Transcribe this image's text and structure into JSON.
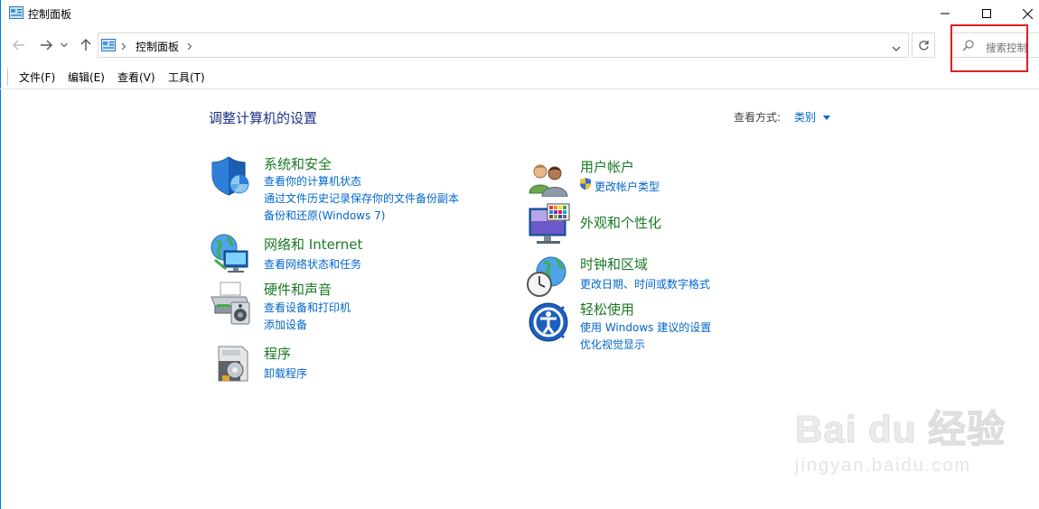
{
  "window": {
    "title": "控制面板"
  },
  "address_bar": {
    "path": "控制面板",
    "search_placeholder": "搜索控制"
  },
  "menu": [
    "文件(F)",
    "编辑(E)",
    "查看(V)",
    "工具(T)"
  ],
  "content": {
    "heading": "调整计算机的设置",
    "view_by_label": "查看方式:",
    "view_by_value": "类别",
    "left_categories": [
      {
        "title": "系统和安全",
        "links": [
          "查看你的计算机状态",
          "通过文件历史记录保存你的文件备份副本",
          "备份和还原(Windows 7)"
        ]
      },
      {
        "title": "网络和 Internet",
        "links": [
          "查看网络状态和任务"
        ]
      },
      {
        "title": "硬件和声音",
        "links": [
          "查看设备和打印机",
          "添加设备"
        ]
      },
      {
        "title": "程序",
        "links": [
          "卸载程序"
        ]
      }
    ],
    "right_categories": [
      {
        "title": "用户帐户",
        "links": [
          "更改帐户类型"
        ]
      },
      {
        "title": "外观和个性化",
        "links": []
      },
      {
        "title": "时钟和区域",
        "links": [
          "更改日期、时间或数字格式"
        ]
      },
      {
        "title": "轻松使用",
        "links": [
          "使用 Windows 建议的设置",
          "优化视觉显示"
        ]
      }
    ]
  },
  "watermark": {
    "brand": "Bai du 经验",
    "url": "jingyan.baidu.com"
  },
  "colors": {
    "link": "#0066cc",
    "category": "#1a7a26",
    "heading": "#1e3287",
    "highlight": "#e02020"
  }
}
